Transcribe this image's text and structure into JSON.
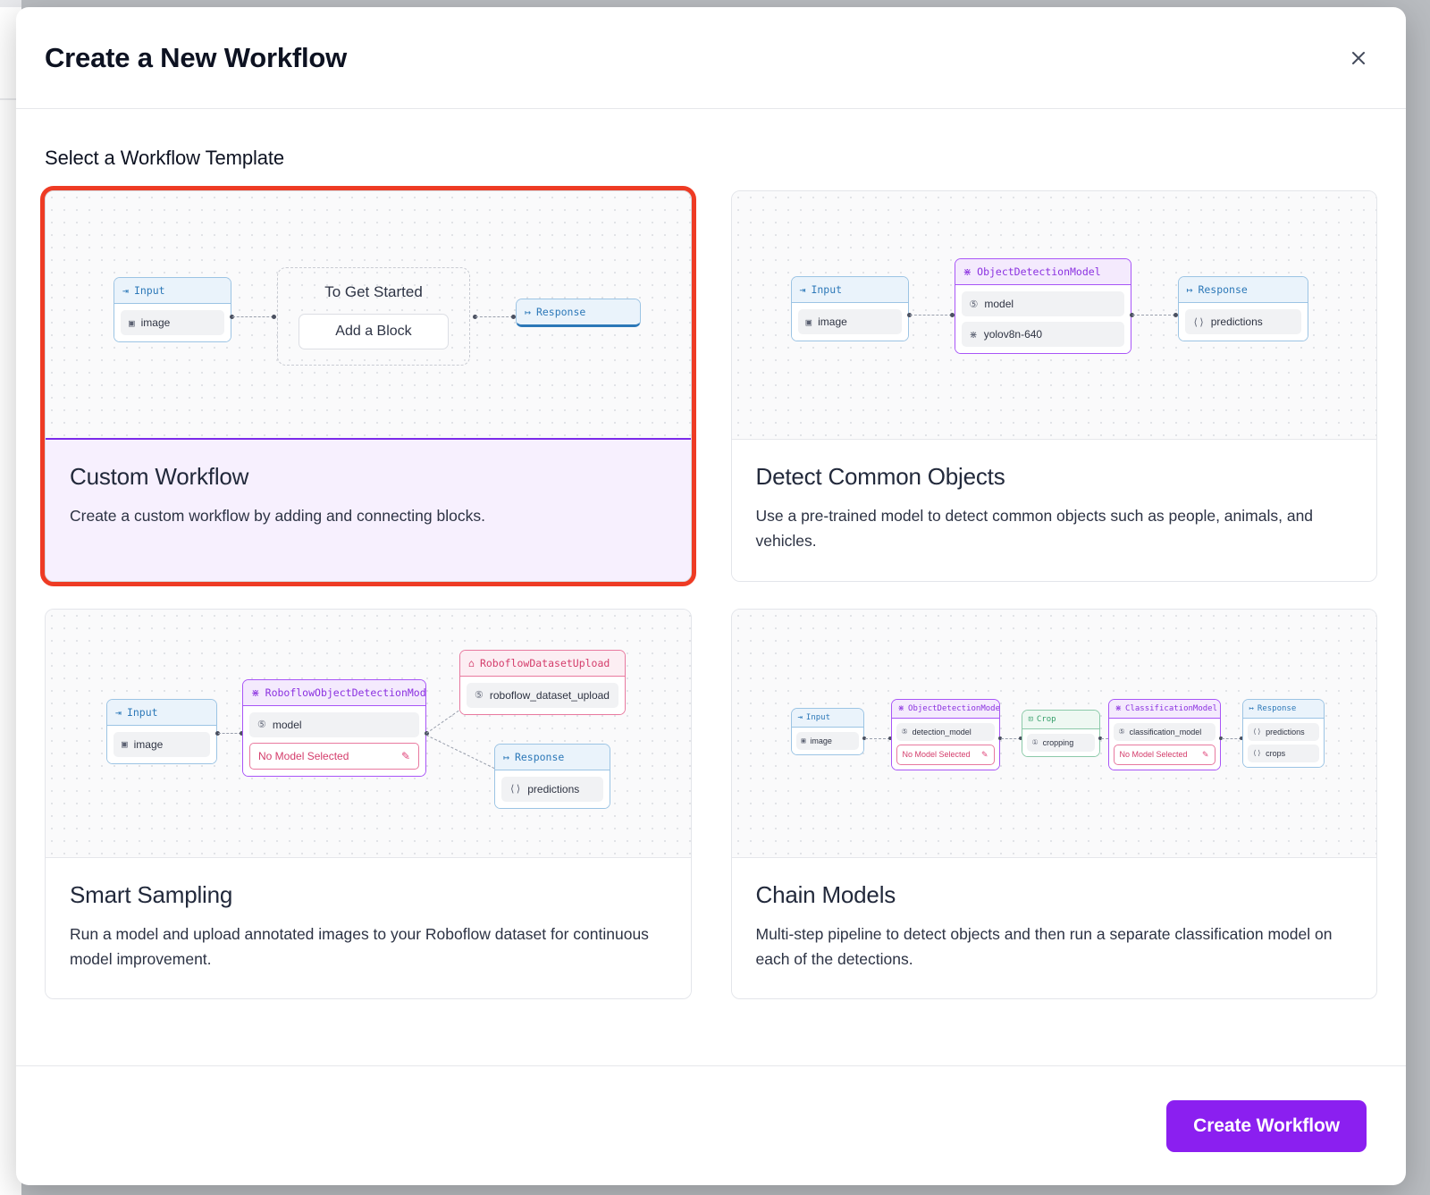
{
  "dialog": {
    "title": "Create a New Workflow",
    "close_icon": "close-icon",
    "section_title": "Select a Workflow Template",
    "footer": {
      "primary_label": "Create Workflow"
    }
  },
  "templates": [
    {
      "id": "custom-workflow",
      "name": "Custom Workflow",
      "description": "Create a custom workflow by adding and connecting blocks.",
      "selected": true,
      "highlight_color": "#ee3b24",
      "accent_color": "#7c2bea",
      "preview": {
        "placeholder_title": "To Get Started",
        "add_block_label": "Add a Block",
        "nodes": [
          {
            "head": "Input",
            "icon": "input-arrow-icon",
            "fields": [
              {
                "label": "image",
                "icon": "image-icon"
              }
            ]
          },
          {
            "head": "Response",
            "icon": "response-arrow-icon",
            "fields": []
          }
        ]
      }
    },
    {
      "id": "detect-common-objects",
      "name": "Detect Common Objects",
      "description": "Use a pre-trained model to detect common objects such as people, animals, and vehicles.",
      "selected": false,
      "preview": {
        "nodes": [
          {
            "head": "Input",
            "icon": "input-arrow-icon",
            "fields": [
              {
                "label": "image",
                "icon": "image-icon"
              }
            ]
          },
          {
            "head": "ObjectDetectionModel",
            "icon": "model-graph-icon",
            "fields": [
              {
                "label": "model",
                "icon": "string-icon"
              },
              {
                "label": "yolov8n-640",
                "icon": "model-graph-icon"
              }
            ]
          },
          {
            "head": "Response",
            "icon": "response-arrow-icon",
            "fields": [
              {
                "label": "predictions",
                "icon": "braces-icon"
              }
            ]
          }
        ]
      }
    },
    {
      "id": "smart-sampling",
      "name": "Smart Sampling",
      "description": "Run a model and upload annotated images to your Roboflow dataset for continuous model improvement.",
      "selected": false,
      "preview": {
        "nodes": [
          {
            "head": "Input",
            "icon": "input-arrow-icon",
            "fields": [
              {
                "label": "image",
                "icon": "image-icon"
              }
            ]
          },
          {
            "head": "RoboflowObjectDetectionModel",
            "icon": "model-graph-icon",
            "fields": [
              {
                "label": "model",
                "icon": "string-icon"
              },
              {
                "label": "No Model Selected",
                "icon": "pencil-icon",
                "state": "warn"
              }
            ]
          },
          {
            "head": "RoboflowDatasetUpload",
            "icon": "upload-icon",
            "fields": [
              {
                "label": "roboflow_dataset_upload",
                "icon": "string-icon"
              }
            ]
          },
          {
            "head": "Response",
            "icon": "response-arrow-icon",
            "fields": [
              {
                "label": "predictions",
                "icon": "braces-icon"
              }
            ]
          }
        ]
      }
    },
    {
      "id": "chain-models",
      "name": "Chain Models",
      "description": "Multi-step pipeline to detect objects and then run a separate classification model on each of the detections.",
      "selected": false,
      "preview": {
        "nodes": [
          {
            "head": "Input",
            "icon": "input-arrow-icon",
            "fields": [
              {
                "label": "image",
                "icon": "image-icon"
              }
            ]
          },
          {
            "head": "ObjectDetectionModel",
            "icon": "model-graph-icon",
            "fields": [
              {
                "label": "detection_model",
                "icon": "string-icon"
              },
              {
                "label": "No Model Selected",
                "icon": "pencil-icon",
                "state": "warn"
              }
            ]
          },
          {
            "head": "Crop",
            "icon": "crop-icon",
            "fields": [
              {
                "label": "cropping",
                "icon": "box-icon"
              }
            ]
          },
          {
            "head": "ClassificationModel",
            "icon": "model-graph-icon",
            "fields": [
              {
                "label": "classification_model",
                "icon": "string-icon"
              },
              {
                "label": "No Model Selected",
                "icon": "pencil-icon",
                "state": "warn"
              }
            ]
          },
          {
            "head": "Response",
            "icon": "response-arrow-icon",
            "fields": [
              {
                "label": "predictions",
                "icon": "braces-icon"
              },
              {
                "label": "crops",
                "icon": "braces-icon"
              }
            ]
          }
        ]
      }
    }
  ]
}
